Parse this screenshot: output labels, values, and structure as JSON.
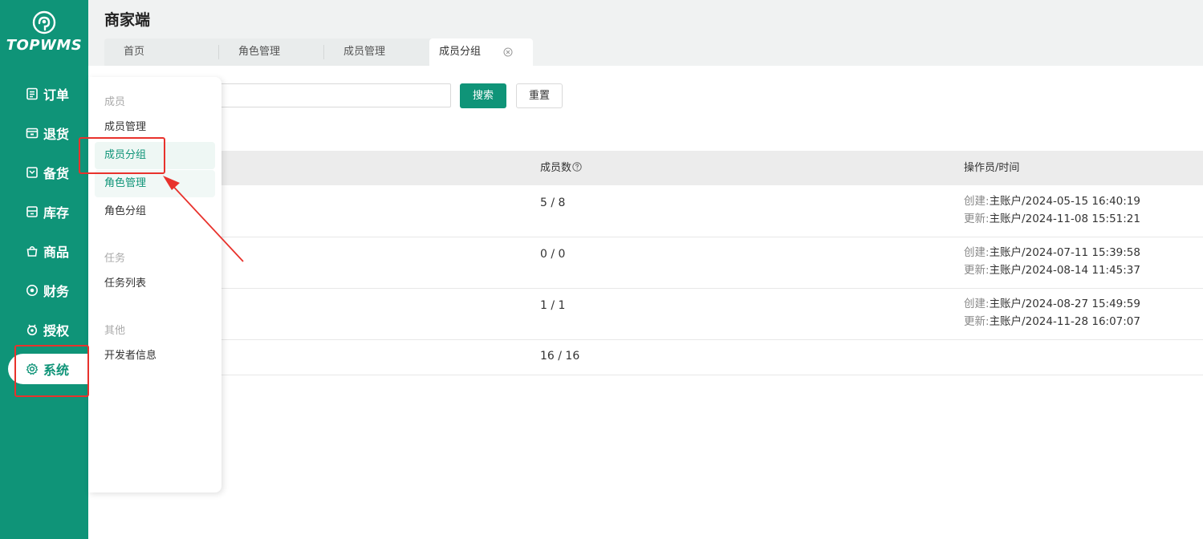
{
  "sidebar": {
    "logo_text": "TOPWMS",
    "items": [
      {
        "label": "订单",
        "icon": "order-icon"
      },
      {
        "label": "退货",
        "icon": "return-icon"
      },
      {
        "label": "备货",
        "icon": "stock-prep-icon"
      },
      {
        "label": "库存",
        "icon": "inventory-icon"
      },
      {
        "label": "商品",
        "icon": "goods-icon"
      },
      {
        "label": "财务",
        "icon": "finance-icon"
      },
      {
        "label": "授权",
        "icon": "authorize-icon"
      },
      {
        "label": "系统",
        "icon": "gear-icon",
        "active": true
      }
    ]
  },
  "header": {
    "title": "商家端",
    "tabs": [
      {
        "label": "首页"
      },
      {
        "label": "角色管理"
      },
      {
        "label": "成员管理"
      },
      {
        "label": "成员分组",
        "active": true
      }
    ]
  },
  "toolbar": {
    "search_button": "搜索",
    "reset_button": "重置"
  },
  "table": {
    "columns": {
      "count": "成员数",
      "operator": "操作员/时间"
    },
    "rows": [
      {
        "count": "5 / 8",
        "created_label": "创建:",
        "created": "主账户/2024-05-15 16:40:19",
        "updated_label": "更新:",
        "updated": "主账户/2024-11-08 15:51:21"
      },
      {
        "count": "0 / 0",
        "created_label": "创建:",
        "created": "主账户/2024-07-11 15:39:58",
        "updated_label": "更新:",
        "updated": "主账户/2024-08-14 11:45:37"
      },
      {
        "count": "1 / 1",
        "created_label": "创建:",
        "created": "主账户/2024-08-27 15:49:59",
        "updated_label": "更新:",
        "updated": "主账户/2024-11-28 16:07:07"
      },
      {
        "count": "16 / 16"
      }
    ]
  },
  "flyout": {
    "groups": [
      {
        "title": "成员",
        "items": [
          "成员管理",
          "成员分组",
          "角色管理",
          "角色分组"
        ]
      },
      {
        "title": "任务",
        "items": [
          "任务列表"
        ]
      },
      {
        "title": "其他",
        "items": [
          "开发者信息"
        ]
      }
    ]
  },
  "colors": {
    "brand": "#0f9478",
    "annotation": "#e8322c"
  }
}
